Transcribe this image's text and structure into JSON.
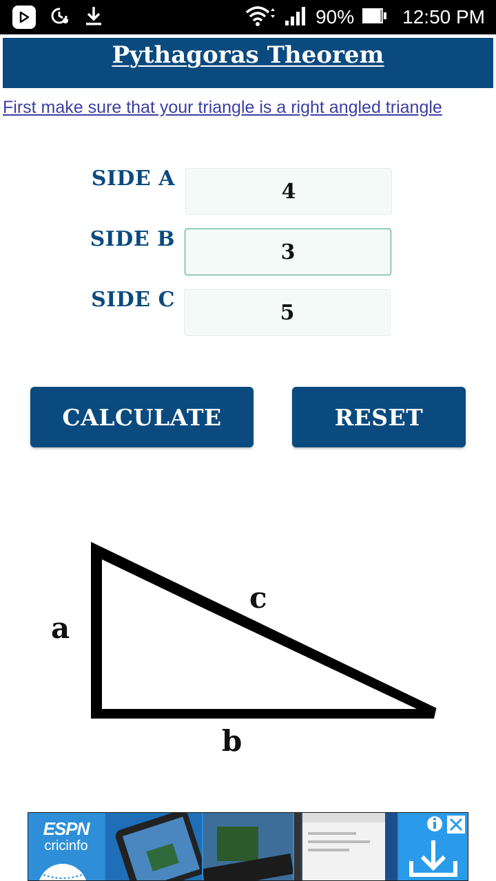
{
  "status_bar": {
    "battery_percent": "90%",
    "time": "12:50 PM"
  },
  "header": {
    "title": "Pythagoras Theorem"
  },
  "subtitle_link": "First make sure that your triangle is a right angled triangle",
  "form": {
    "side_a": {
      "label": "SIDE A",
      "value": "4"
    },
    "side_b": {
      "label": "SIDE B",
      "value": "3"
    },
    "side_c": {
      "label": "SIDE C",
      "value": "5"
    }
  },
  "buttons": {
    "calculate": "CALCULATE",
    "reset": "RESET"
  },
  "diagram": {
    "label_a": "a",
    "label_b": "b",
    "label_c": "c"
  },
  "ad": {
    "brand_line1": "ESPN",
    "brand_line2": "cricinfo"
  },
  "colors": {
    "primary": "#0b4a7e",
    "link": "#3a3fa3",
    "input_bg": "#f4faf8",
    "focus_border": "#3aa37a",
    "ad_blue": "#2a8bd6"
  },
  "icons": [
    "play-store-icon",
    "sync-icon",
    "download-icon",
    "wifi-icon",
    "signal-icon",
    "battery-icon",
    "info-icon",
    "close-icon",
    "download-arrow-icon"
  ]
}
